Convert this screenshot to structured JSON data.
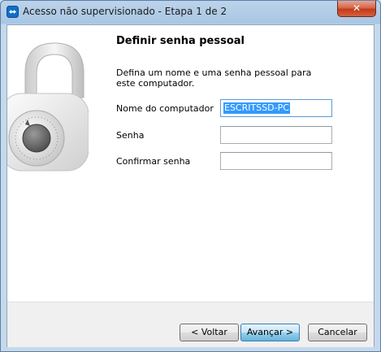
{
  "window": {
    "title": "Acesso não supervisionado - Etapa 1 de 2",
    "close_glyph": "✕"
  },
  "page": {
    "heading": "Definir senha pessoal",
    "description": "Defina um nome e uma senha pessoal para este computador."
  },
  "form": {
    "computer_name_label": "Nome do computador",
    "computer_name_value": "ESCRITSSD-PC",
    "password_label": "Senha",
    "password_value": "",
    "confirm_label": "Confirmar senha",
    "confirm_value": ""
  },
  "buttons": {
    "back": "< Voltar",
    "next": "Avançar >",
    "cancel": "Cancelar"
  },
  "icons": {
    "app": "teamviewer-icon",
    "illustration": "padlock-icon"
  }
}
